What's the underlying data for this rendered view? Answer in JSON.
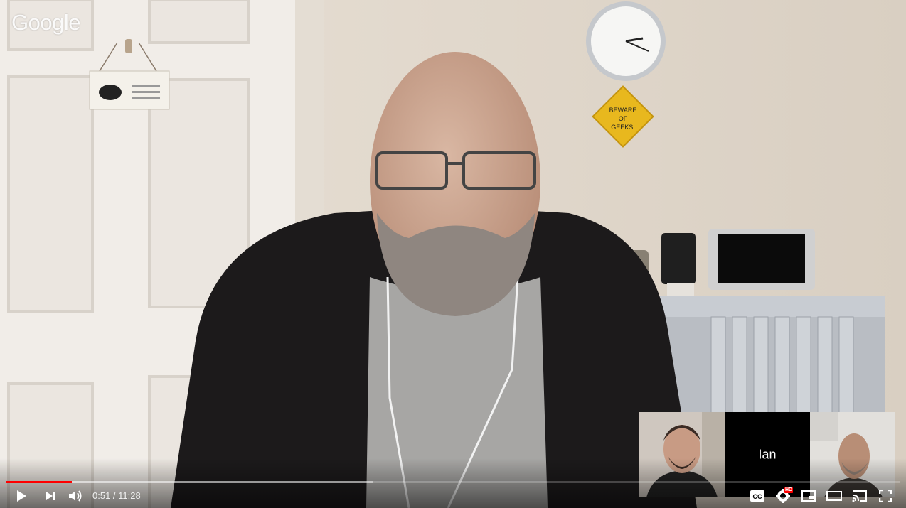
{
  "video": {
    "watermark": "Google",
    "sign_text": "BEWARE OF GEEKS!"
  },
  "participants": [
    {
      "name": "",
      "type": "video"
    },
    {
      "name": "Ian",
      "type": "name-only"
    },
    {
      "name": "",
      "type": "video"
    }
  ],
  "player": {
    "progress_played_fraction": 0.074,
    "progress_loaded_fraction": 0.41,
    "current_time": "0:51",
    "separator": "/",
    "duration": "11:28",
    "time_display": "0:51 / 11:28",
    "hd_badge": "HD"
  },
  "controls": [
    "play-icon",
    "next-icon",
    "volume-icon",
    "captions-icon",
    "settings-icon",
    "miniplayer-icon",
    "theater-mode-icon",
    "cast-icon",
    "fullscreen-icon"
  ],
  "colors": {
    "progress": "#ff0000",
    "hd_badge": "#ff0000"
  }
}
